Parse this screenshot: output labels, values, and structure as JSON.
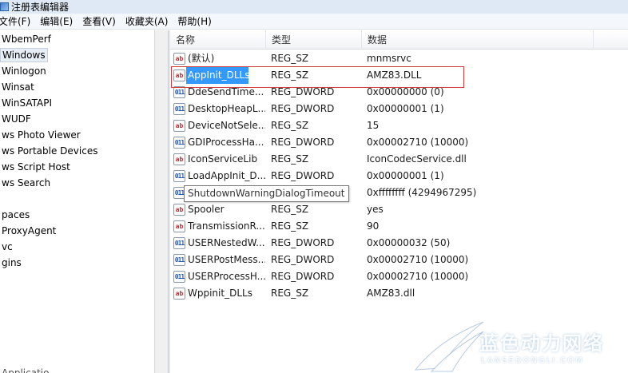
{
  "window": {
    "title": "注册表编辑器"
  },
  "menu": [
    "文件(F)",
    "编辑(E)",
    "查看(V)",
    "收藏夹(A)",
    "帮助(H)"
  ],
  "tree": {
    "items": [
      "WbemPerf",
      "Windows",
      "Winlogon",
      "Winsat",
      "WinSATAPI",
      "WUDF",
      "ws Photo Viewer",
      "ws Portable Devices",
      "ws Script Host",
      "ws Search",
      "",
      "paces",
      "ProxyAgent",
      "vc",
      "gins"
    ],
    "selected_index": 1,
    "partial_bottom": "Applicatio"
  },
  "columns": {
    "name": "名称",
    "type": "类型",
    "data": "数据"
  },
  "rows": [
    {
      "name": "(默认)",
      "type": "REG_SZ",
      "data": "mnmsrvc",
      "icon": "sz"
    },
    {
      "name": "AppInit_DLLs",
      "type": "REG_SZ",
      "data": "AMZ83.DLL",
      "icon": "sz"
    },
    {
      "name": "DdeSendTime...",
      "type": "REG_DWORD",
      "data": "0x00000000 (0)",
      "icon": "dword"
    },
    {
      "name": "DesktopHeapL...",
      "type": "REG_DWORD",
      "data": "0x00000001 (1)",
      "icon": "dword"
    },
    {
      "name": "DeviceNotSele...",
      "type": "REG_SZ",
      "data": "15",
      "icon": "sz"
    },
    {
      "name": "GDIProcessHa...",
      "type": "REG_DWORD",
      "data": "0x00002710 (10000)",
      "icon": "dword"
    },
    {
      "name": "IconServiceLib",
      "type": "REG_SZ",
      "data": "IconCodecService.dll",
      "icon": "sz"
    },
    {
      "name": "LoadAppInit_D...",
      "type": "REG_DWORD",
      "data": "0x00000001 (1)",
      "icon": "dword"
    },
    {
      "name": "",
      "type": "",
      "data": "0xffffffff (4294967295)",
      "icon": "dword"
    },
    {
      "name": "Spooler",
      "type": "REG_SZ",
      "data": "yes",
      "icon": "sz"
    },
    {
      "name": "TransmissionR...",
      "type": "REG_SZ",
      "data": "90",
      "icon": "sz"
    },
    {
      "name": "USERNestedW...",
      "type": "REG_DWORD",
      "data": "0x00000032 (50)",
      "icon": "dword"
    },
    {
      "name": "USERPostMess...",
      "type": "REG_DWORD",
      "data": "0x00002710 (10000)",
      "icon": "dword"
    },
    {
      "name": "USERProcessH...",
      "type": "REG_DWORD",
      "data": "0x00002710 (10000)",
      "icon": "dword"
    },
    {
      "name": "Wppinit_DLLs",
      "type": "REG_SZ",
      "data": "AMZ83.dll",
      "icon": "sz"
    }
  ],
  "selected_row_index": 1,
  "tooltip": "ShutdownWarningDialogTimeout",
  "icons": {
    "sz": "ab",
    "dword": "011"
  },
  "watermark": {
    "cn": "蓝色动力网络",
    "en": "LANSEDONGLI.COM"
  },
  "colors": {
    "selection": "#3399ff",
    "highlight_border": "#d33a3a"
  }
}
